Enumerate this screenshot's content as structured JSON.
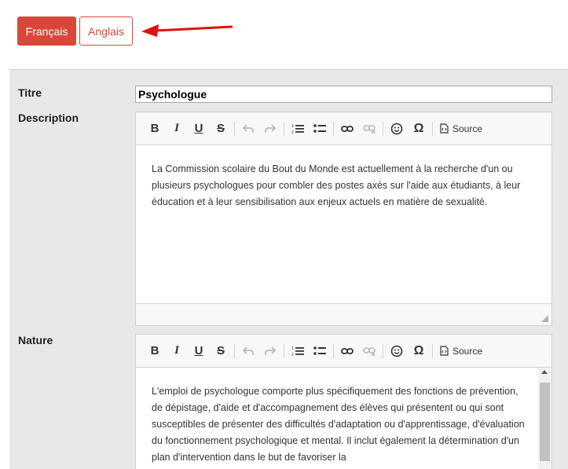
{
  "language_buttons": {
    "french": "Français",
    "english": "Anglais"
  },
  "form": {
    "title_label": "Titre",
    "title_value": "Psychologue",
    "description_label": "Description",
    "nature_label": "Nature"
  },
  "editor_toolbar": {
    "bold": "B",
    "italic": "I",
    "underline": "U",
    "strike": "S",
    "special_char": "Ω",
    "source_label": "Source"
  },
  "description_text": "La Commission scolaire du Bout du Monde est actuellement à la recherche d'un ou plusieurs psychologues pour combler des postes axés sur l'aide aux étudiants, à leur éducation et à leur sensibilisation aux enjeux actuels en matière de sexualité.",
  "nature_text": "L'emploi de psychologue comporte plus spécifiquement des fonctions de prévention, de dépistage, d'aide et d'accompagnement des élèves qui présentent ou qui sont susceptibles de présenter des difficultés d'adaptation ou d'apprentissage, d'évaluation du fonctionnement psychologique et mental. Il inclut également la détermination d'un plan d'intervention dans le but de favoriser la",
  "colors": {
    "accent": "#d9473b",
    "arrow": "#e01010",
    "panel_bg": "#e8e8e8"
  }
}
